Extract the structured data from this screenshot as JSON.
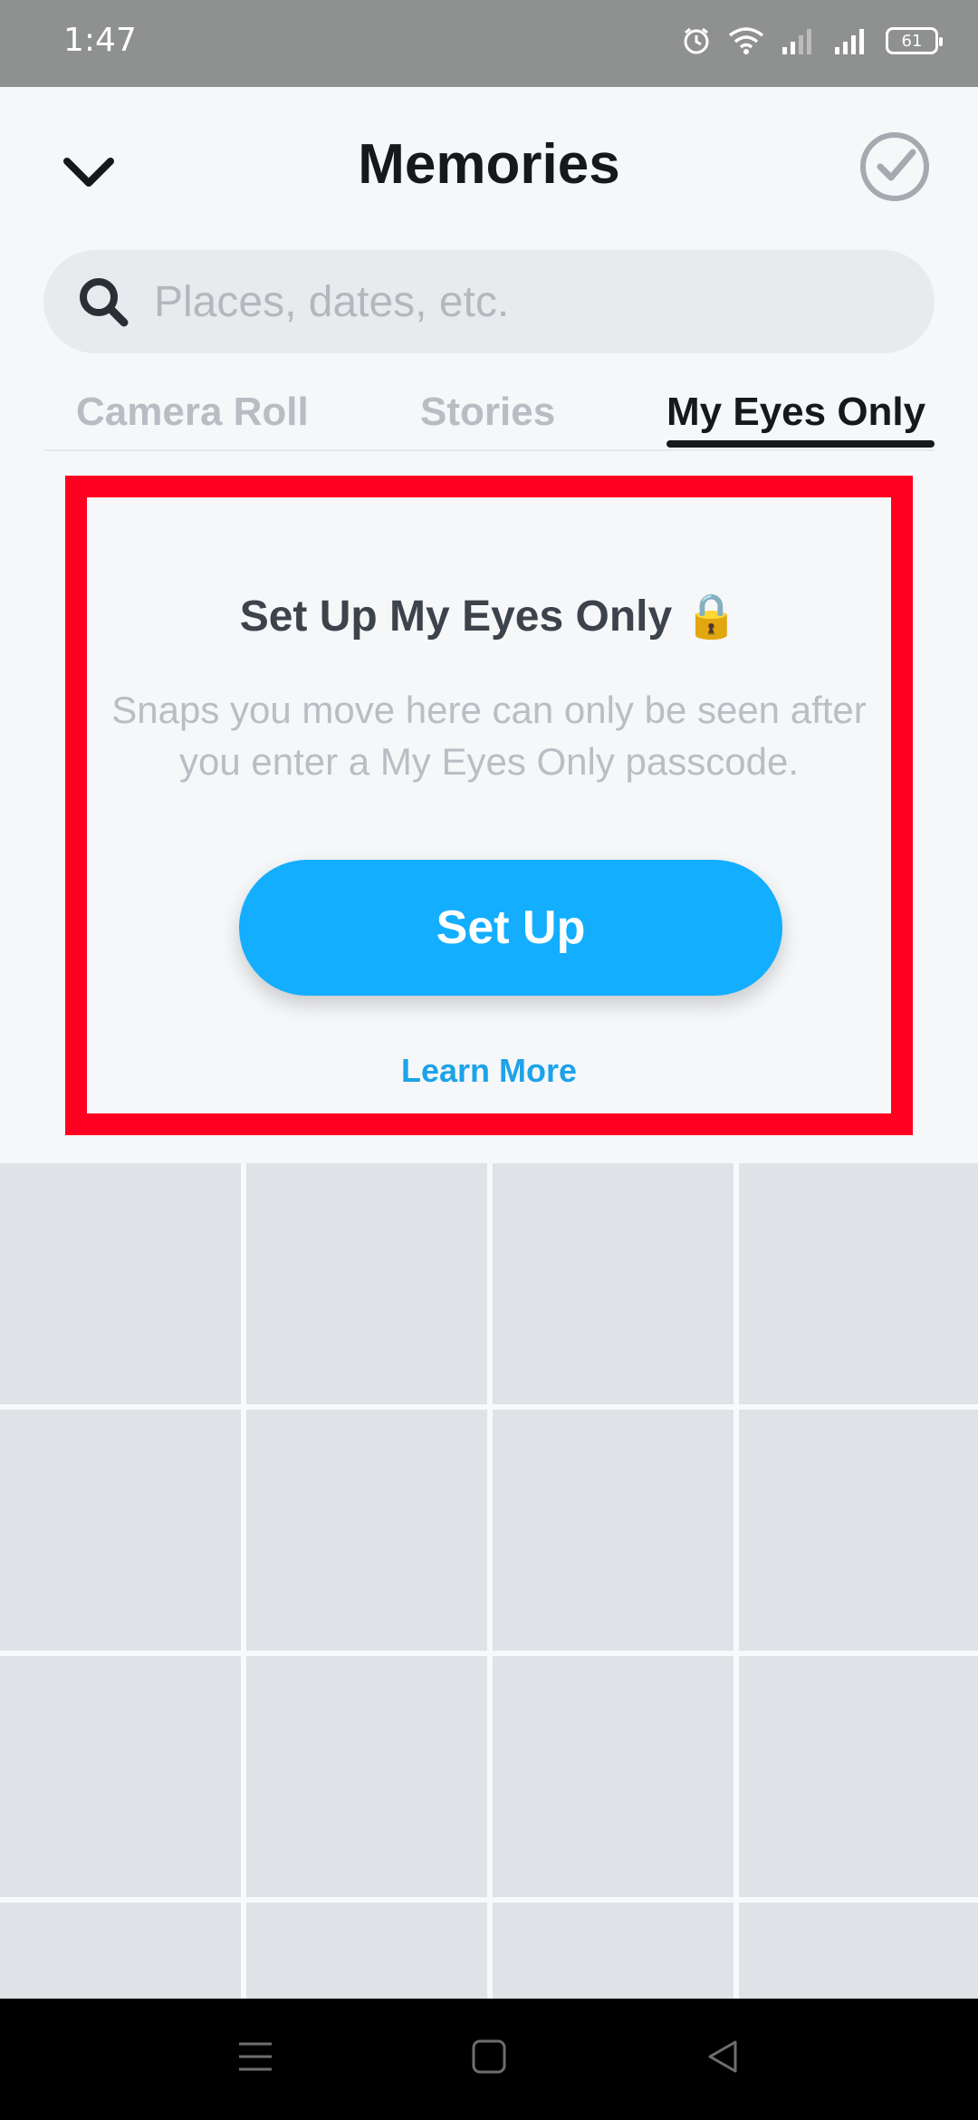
{
  "status_bar": {
    "time": "1:47",
    "battery": "61"
  },
  "header": {
    "title": "Memories"
  },
  "search": {
    "placeholder": "Places, dates, etc."
  },
  "tabs": [
    {
      "label": "Camera Roll",
      "active": false
    },
    {
      "label": "Stories",
      "active": false
    },
    {
      "label": "My Eyes Only",
      "active": true
    }
  ],
  "setup": {
    "title": "Set Up My Eyes Only 🔒",
    "description": "Snaps you move here can only be seen after you enter a My Eyes Only passcode.",
    "button_label": "Set Up",
    "learn_more": "Learn More"
  },
  "colors": {
    "accent_blue": "#13AEFE",
    "link_blue": "#1CA3E8",
    "highlight_red": "#FF0020",
    "placeholder_gray": "#DFE2E6"
  },
  "icons": [
    "chevron-down-icon",
    "check-circle-icon",
    "search-icon",
    "alarm-icon",
    "wifi-icon",
    "signal-icon",
    "menu-icon",
    "home-icon",
    "back-icon"
  ]
}
